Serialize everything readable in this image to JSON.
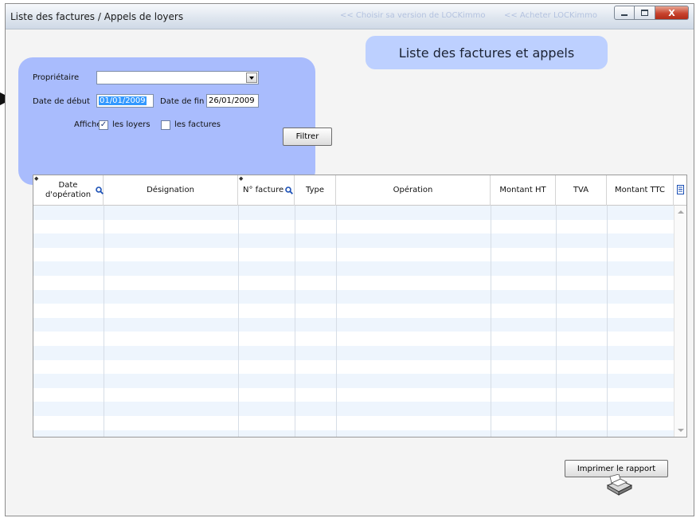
{
  "window": {
    "title": "Liste des factures / Appels de loyers",
    "ghost_links": [
      "<< Choisir sa version de LOCKimmo",
      "<< Acheter LOCKimmo"
    ],
    "controls": {
      "close_glyph": "X"
    }
  },
  "header": {
    "title": "Liste des factures et appels"
  },
  "filter": {
    "proprietaire_label": "Propriétaire",
    "proprietaire_value": "",
    "date_debut_label": "Date de début",
    "date_debut_value": "01/01/2009",
    "date_fin_label": "Date de fin",
    "date_fin_value": "26/01/2009",
    "afficher_label": "Afficher",
    "loyers_label": "les loyers",
    "loyers_checked": true,
    "factures_label": "les factures",
    "factures_checked": false,
    "filtrer_button": "Filtrer"
  },
  "table": {
    "columns": [
      {
        "label": "Date d'opération",
        "sortable": true,
        "searchable": true
      },
      {
        "label": "Désignation"
      },
      {
        "label": "N° facture",
        "sortable": true,
        "searchable": true
      },
      {
        "label": "Type"
      },
      {
        "label": "Opération"
      },
      {
        "label": "Montant HT"
      },
      {
        "label": "TVA"
      },
      {
        "label": "Montant TTC"
      }
    ],
    "rows": []
  },
  "footer": {
    "print_button": "Imprimer le rapport"
  },
  "colors": {
    "panel": "#a9bcfd",
    "header_pill": "#bdd0ff",
    "row_alt": "#eef5fd",
    "selection": "#3399ff"
  },
  "icons": [
    "search-icon",
    "column-chooser-icon",
    "printer-icon",
    "sort-indicator-icon"
  ]
}
